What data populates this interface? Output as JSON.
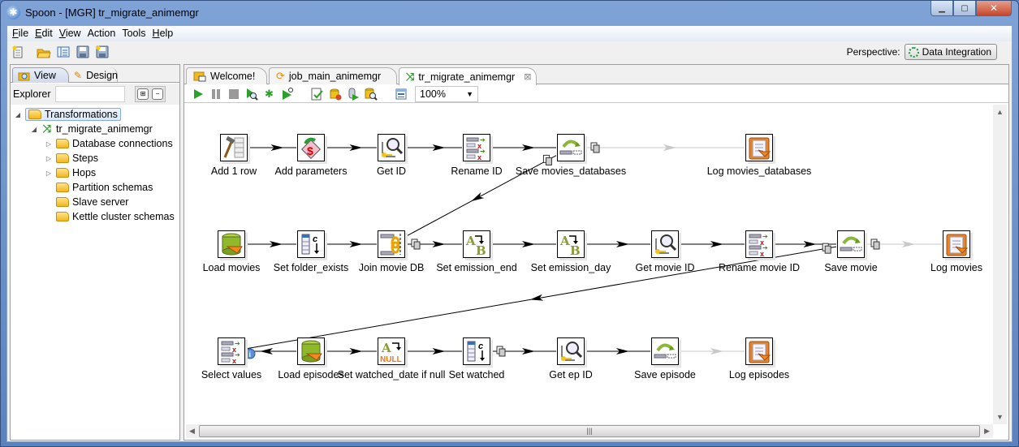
{
  "window": {
    "title": "Spoon - [MGR] tr_migrate_animemgr",
    "app_icon": "spoon-icon",
    "buttons": [
      "minimize",
      "maximize",
      "close"
    ]
  },
  "menu": [
    {
      "label": "File",
      "accel": "F"
    },
    {
      "label": "Edit",
      "accel": "E"
    },
    {
      "label": "View",
      "accel": "V"
    },
    {
      "label": "Action",
      "accel": ""
    },
    {
      "label": "Tools",
      "accel": ""
    },
    {
      "label": "Help",
      "accel": "H"
    }
  ],
  "main_toolbar": [
    "new-file-icon",
    "open-folder-icon",
    "explore-repository-icon",
    "save-icon",
    "save-as-icon"
  ],
  "perspective": {
    "label": "Perspective:",
    "value": "Data Integration"
  },
  "left_panel": {
    "tabs": [
      {
        "label": "View",
        "active": true
      },
      {
        "label": "Design",
        "active": false
      }
    ],
    "explorer_label": "Explorer",
    "explorer_value": "",
    "tree": [
      {
        "label": "Transformations",
        "level": 0,
        "expanded": true,
        "selected": true,
        "icon": "folder"
      },
      {
        "label": "tr_migrate_animemgr",
        "level": 1,
        "expanded": true,
        "icon": "transformation"
      },
      {
        "label": "Database connections",
        "level": 2,
        "expandable": true,
        "icon": "folder"
      },
      {
        "label": "Steps",
        "level": 2,
        "expandable": true,
        "icon": "folder"
      },
      {
        "label": "Hops",
        "level": 2,
        "expandable": true,
        "icon": "folder"
      },
      {
        "label": "Partition schemas",
        "level": 2,
        "expandable": false,
        "icon": "folder"
      },
      {
        "label": "Slave server",
        "level": 2,
        "expandable": false,
        "icon": "folder"
      },
      {
        "label": "Kettle cluster schemas",
        "level": 2,
        "expandable": false,
        "icon": "folder"
      }
    ]
  },
  "tabs": [
    {
      "label": "Welcome!",
      "icon": "welcome-icon",
      "active": false
    },
    {
      "label": "job_main_animemgr",
      "icon": "job-icon",
      "active": false
    },
    {
      "label": "tr_migrate_animemgr",
      "icon": "transformation-icon",
      "active": true,
      "closable": true
    }
  ],
  "canvas_toolbar": {
    "buttons": [
      "run",
      "pause",
      "stop",
      "preview",
      "debug",
      "replay",
      "verify",
      "impact",
      "sql",
      "explore-db",
      "show-results"
    ],
    "zoom": "100%"
  },
  "steps": [
    {
      "id": "add1row",
      "label": "Add 1 row",
      "icon": "generate-rows",
      "row": 0
    },
    {
      "id": "addparams",
      "label": "Add parameters",
      "icon": "get-variables",
      "row": 0
    },
    {
      "id": "getid",
      "label": "Get ID",
      "icon": "db-lookup",
      "row": 0
    },
    {
      "id": "renameid",
      "label": "Rename ID",
      "icon": "select-values",
      "row": 0
    },
    {
      "id": "savemdb",
      "label": "Save movies_databases",
      "icon": "insert-update",
      "row": 0
    },
    {
      "id": "logmdb",
      "label": "Log movies_databases",
      "icon": "write-to-log",
      "row": 0
    },
    {
      "id": "loadmovies",
      "label": "Load movies",
      "icon": "table-input",
      "row": 1
    },
    {
      "id": "setfolder",
      "label": "Set folder_exists",
      "icon": "calculator",
      "row": 1
    },
    {
      "id": "joinmovie",
      "label": "Join movie DB",
      "icon": "stream-lookup",
      "row": 1
    },
    {
      "id": "setemend",
      "label": "Set emission_end",
      "icon": "value-mapper",
      "row": 1
    },
    {
      "id": "setemday",
      "label": "Set emission_day",
      "icon": "value-mapper",
      "row": 1
    },
    {
      "id": "getmovieid",
      "label": "Get movie ID",
      "icon": "db-lookup",
      "row": 1
    },
    {
      "id": "renamemovieid",
      "label": "Rename movie ID",
      "icon": "select-values",
      "row": 1
    },
    {
      "id": "savemovie",
      "label": "Save movie",
      "icon": "insert-update",
      "row": 1
    },
    {
      "id": "logmovies",
      "label": "Log movies",
      "icon": "write-to-log",
      "row": 1
    },
    {
      "id": "selectvalues",
      "label": "Select values",
      "icon": "select-values",
      "row": 2
    },
    {
      "id": "loadepisodes",
      "label": "Load episodes",
      "icon": "table-input",
      "row": 2
    },
    {
      "id": "setwatcheddate",
      "label": "Set watched_date if null",
      "icon": "if-null",
      "row": 2
    },
    {
      "id": "setwatched",
      "label": "Set watched",
      "icon": "calculator",
      "row": 2
    },
    {
      "id": "getepid",
      "label": "Get ep ID",
      "icon": "db-lookup",
      "row": 2
    },
    {
      "id": "saveepisode",
      "label": "Save episode",
      "icon": "insert-update",
      "row": 2
    },
    {
      "id": "logepisodes",
      "label": "Log episodes",
      "icon": "write-to-log",
      "row": 2
    }
  ],
  "hops": [
    {
      "from": "add1row",
      "to": "addparams",
      "enabled": true
    },
    {
      "from": "addparams",
      "to": "getid",
      "enabled": true
    },
    {
      "from": "getid",
      "to": "renameid",
      "enabled": true
    },
    {
      "from": "renameid",
      "to": "savemdb",
      "enabled": true
    },
    {
      "from": "savemdb",
      "to": "logmdb",
      "enabled": false,
      "copy": true
    },
    {
      "from": "savemdb",
      "to": "joinmovie",
      "enabled": true,
      "copy": true
    },
    {
      "from": "loadmovies",
      "to": "setfolder",
      "enabled": true
    },
    {
      "from": "setfolder",
      "to": "joinmovie",
      "enabled": true
    },
    {
      "from": "joinmovie",
      "to": "setemend",
      "enabled": true,
      "copy": true
    },
    {
      "from": "setemend",
      "to": "setemday",
      "enabled": true
    },
    {
      "from": "setemday",
      "to": "getmovieid",
      "enabled": true
    },
    {
      "from": "getmovieid",
      "to": "renamemovieid",
      "enabled": true
    },
    {
      "from": "renamemovieid",
      "to": "savemovie",
      "enabled": true
    },
    {
      "from": "savemovie",
      "to": "logmovies",
      "enabled": false,
      "copy": true
    },
    {
      "from": "savemovie",
      "to": "selectvalues",
      "enabled": true,
      "copy": true
    },
    {
      "from": "loadepisodes",
      "to": "selectvalues",
      "enabled": true,
      "info": true
    },
    {
      "from": "loadepisodes",
      "to": "setwatcheddate",
      "enabled": true
    },
    {
      "from": "setwatcheddate",
      "to": "setwatched",
      "enabled": true
    },
    {
      "from": "setwatched",
      "to": "getepid",
      "enabled": true,
      "copy": true
    },
    {
      "from": "getepid",
      "to": "saveepisode",
      "enabled": true
    },
    {
      "from": "saveepisode",
      "to": "logepisodes",
      "enabled": false
    }
  ]
}
